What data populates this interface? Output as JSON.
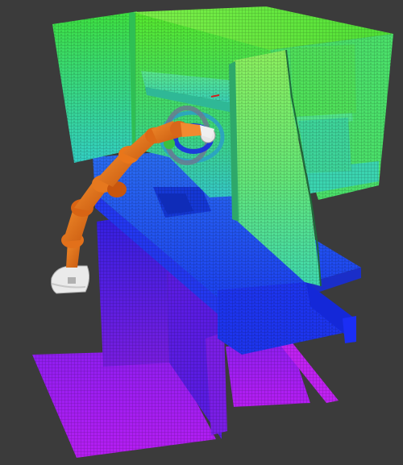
{
  "view": {
    "background": "#3b3b3b",
    "grid_line": "#2a2a2a",
    "colors": {
      "voxel_green": "#3fd14a",
      "voxel_light_green": "#8ff060",
      "voxel_teal": "#3bd0a0",
      "voxel_cyan": "#32c4c8",
      "voxel_blue": "#1a3cf0",
      "voxel_dark_blue": "#2a22c8",
      "voxel_violet": "#6a18e0",
      "voxel_magenta": "#b21ef0",
      "robot_orange": "#e8731a",
      "robot_white": "#e9e9e9"
    }
  },
  "scene": {
    "objects": [
      {
        "name": "left-wall",
        "kind": "voxel-wall"
      },
      {
        "name": "shelf-unit",
        "kind": "voxel-shelf"
      },
      {
        "name": "table",
        "kind": "voxel-table"
      },
      {
        "name": "floor",
        "kind": "voxel-floor"
      },
      {
        "name": "robot-arm",
        "kind": "manipulator"
      },
      {
        "name": "grasp-target-marker",
        "kind": "interactive-marker"
      }
    ]
  }
}
